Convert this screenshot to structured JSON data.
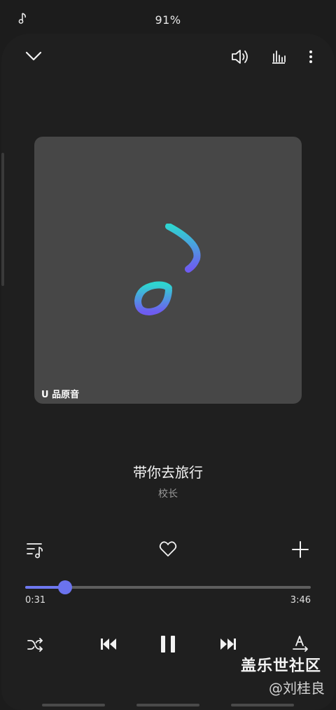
{
  "status": {
    "battery": "91%",
    "icon": "music-note-icon"
  },
  "toolbar": {
    "collapse_icon": "chevron-down-icon",
    "volume_icon": "volume-icon",
    "equalizer_icon": "equalizer-icon",
    "more_icon": "more-vert-icon"
  },
  "album_art": {
    "badge": "U 品原音",
    "icon": "music-note-gradient-icon",
    "gradient": [
      "#2fd4d0",
      "#6e5cf0"
    ]
  },
  "track": {
    "title": "带你去旅行",
    "artist": "校长"
  },
  "actions": {
    "playlist_icon": "playlist-icon",
    "favorite_icon": "heart-icon",
    "add_icon": "plus-icon"
  },
  "progress": {
    "current": "0:31",
    "total": "3:46",
    "fraction": 0.14,
    "accent": "#6e78f0"
  },
  "controls": {
    "shuffle_icon": "shuffle-icon",
    "prev_icon": "skip-previous-icon",
    "play_pause_icon": "pause-icon",
    "next_icon": "skip-next-icon",
    "lyrics_icon": "lyrics-translate-icon"
  },
  "watermark": {
    "line1": "盖乐世社区",
    "line2": "@刘桂良"
  }
}
